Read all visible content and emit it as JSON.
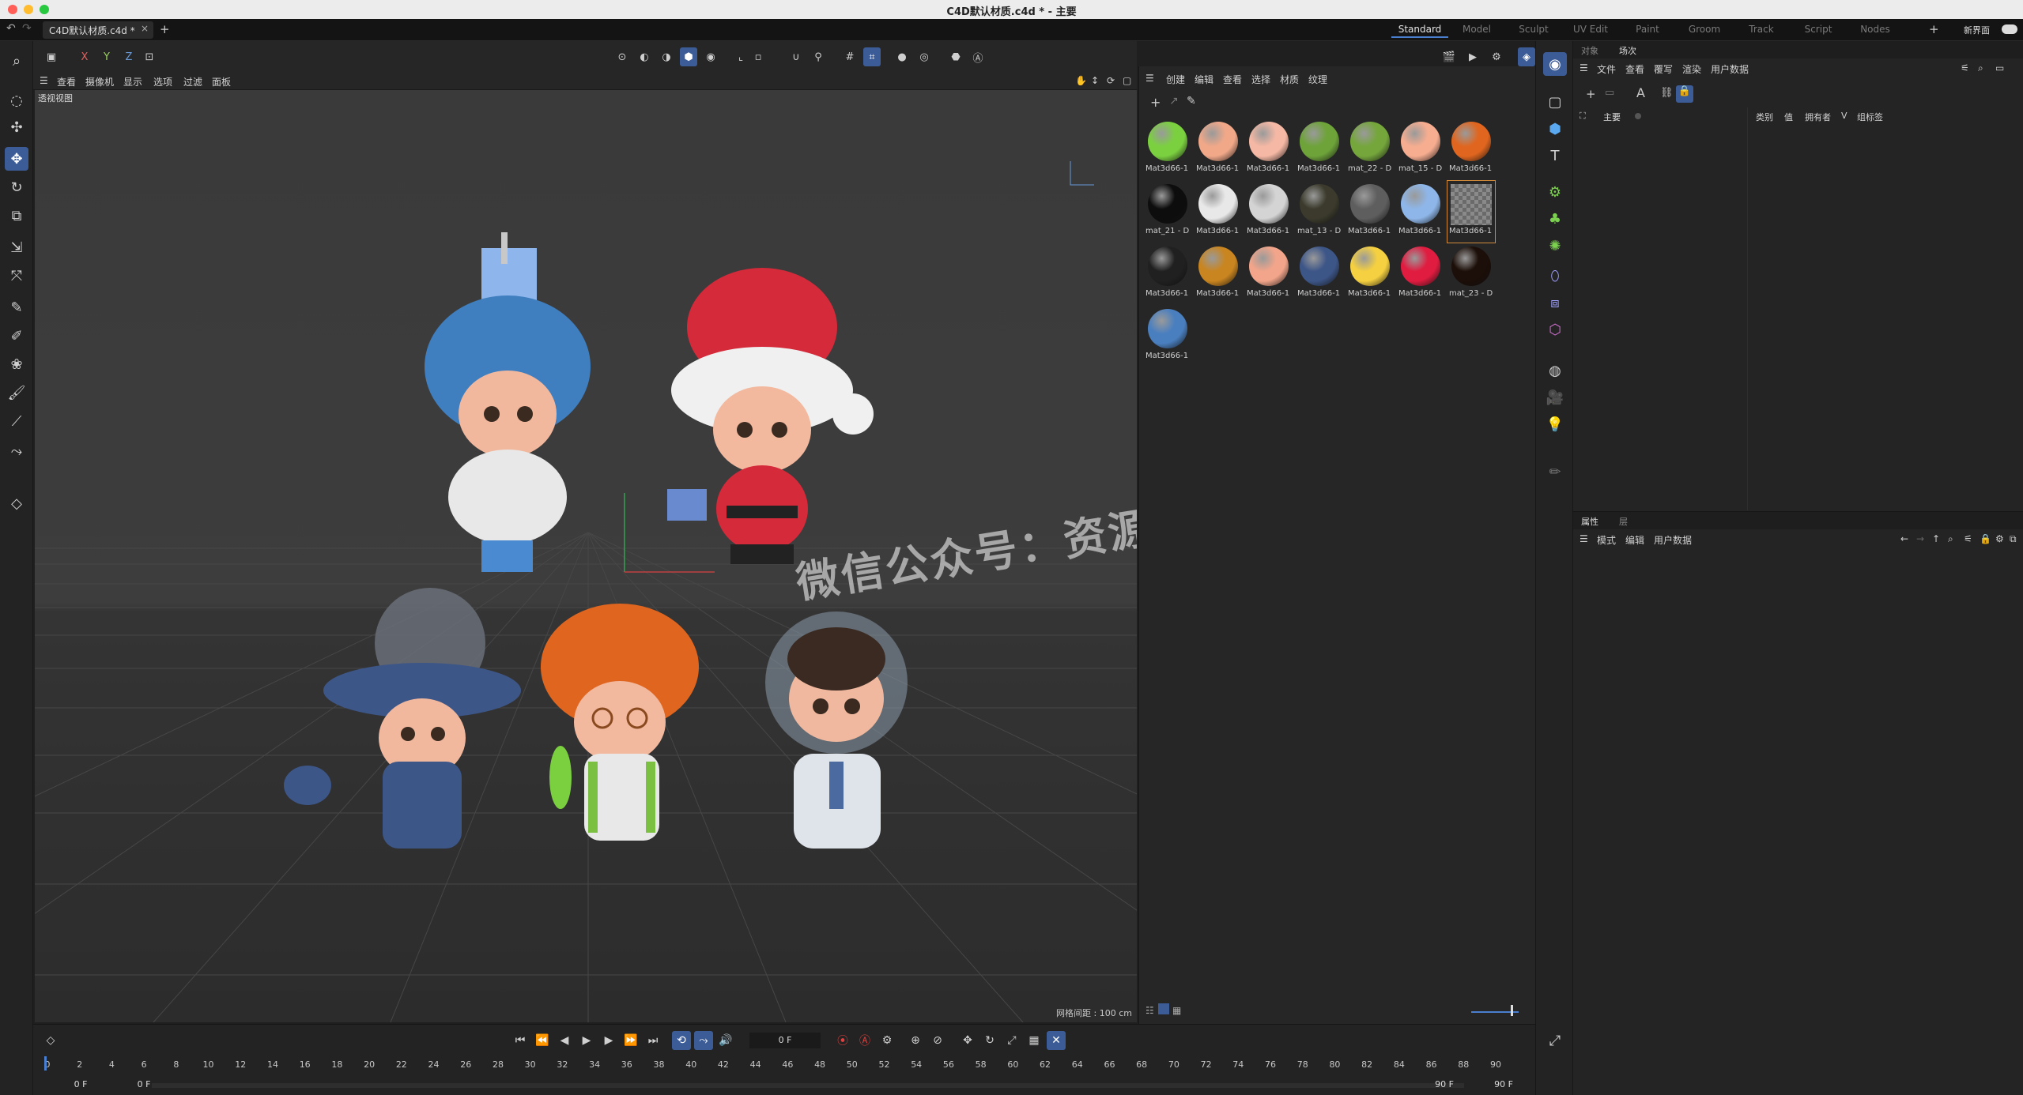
{
  "window": {
    "title": "C4D默认材质.c4d * - 主要"
  },
  "tabs": {
    "doc_tab": "C4D默认材质.c4d *",
    "close_glyph": "×",
    "add_glyph": "+"
  },
  "layouts": {
    "items": [
      "Standard",
      "Model",
      "Sculpt",
      "UV Edit",
      "Paint",
      "Groom",
      "Track",
      "Script",
      "Nodes"
    ],
    "new_layout": "新界面",
    "plus": "+"
  },
  "axis_buttons": {
    "x": "X",
    "y": "Y",
    "z": "Z"
  },
  "viewport_menu": [
    "查看",
    "摄像机",
    "显示",
    "选项",
    "过滤",
    "面板"
  ],
  "viewport": {
    "label": "透视视图",
    "grid_info": "网格间距 : 100 cm",
    "watermark": "微信公众号：资源设"
  },
  "material_menu": [
    "创建",
    "编辑",
    "查看",
    "选择",
    "材质",
    "纹理"
  ],
  "materials": [
    {
      "name": "Mat3d66-1",
      "color": "#7bd040"
    },
    {
      "name": "Mat3d66-1",
      "color": "#f0a889"
    },
    {
      "name": "Mat3d66-1",
      "color": "#f5b8a4"
    },
    {
      "name": "Mat3d66-1",
      "color": "#6ea33a"
    },
    {
      "name": "mat_22 - D",
      "color": "#75a63c"
    },
    {
      "name": "mat_15 - D",
      "color": "#f6ad90"
    },
    {
      "name": "Mat3d66-1",
      "color": "#e0661f"
    },
    {
      "name": "mat_21 - D",
      "color": "#0d0d0d"
    },
    {
      "name": "Mat3d66-1",
      "color": "#e8e8e8"
    },
    {
      "name": "Mat3d66-1",
      "color": "#d4d4d4"
    },
    {
      "name": "mat_13 - D",
      "color": "#3b3a2c"
    },
    {
      "name": "Mat3d66-1",
      "color": "#5e5e5e"
    },
    {
      "name": "Mat3d66-1",
      "color": "#8eb6e8"
    },
    {
      "name": "Mat3d66-1",
      "color": "checker"
    },
    {
      "name": "Mat3d66-1",
      "color": "#202020"
    },
    {
      "name": "Mat3d66-1",
      "color": "#c98520"
    },
    {
      "name": "Mat3d66-1",
      "color": "#f2a58a"
    },
    {
      "name": "Mat3d66-1",
      "color": "#3d5688"
    },
    {
      "name": "Mat3d66-1",
      "color": "#f5d040"
    },
    {
      "name": "Mat3d66-1",
      "color": "#e01c40"
    },
    {
      "name": "mat_23 - D",
      "color": "#1c0e08"
    },
    {
      "name": "Mat3d66-1",
      "color": "#4a7fbf"
    }
  ],
  "object_manager": {
    "tabs": [
      "对象",
      "场次"
    ],
    "menu": [
      "文件",
      "查看",
      "覆写",
      "渲染",
      "用户数据"
    ],
    "root_item": "主要",
    "columns": [
      "类别",
      "值",
      "拥有者",
      "V",
      "组标签"
    ]
  },
  "attributes": {
    "tabs": [
      "属性",
      "层"
    ],
    "menu": [
      "模式",
      "编辑",
      "用户数据"
    ]
  },
  "timeline": {
    "current_frame": "0 F",
    "start_left": "0 F",
    "start_right": "0 F",
    "end_left": "90 F",
    "end_right": "90 F",
    "ticks": [
      "0",
      "2",
      "4",
      "6",
      "8",
      "10",
      "12",
      "14",
      "16",
      "18",
      "20",
      "22",
      "24",
      "26",
      "28",
      "30",
      "32",
      "34",
      "36",
      "38",
      "40",
      "42",
      "44",
      "46",
      "48",
      "50",
      "52",
      "54",
      "56",
      "58",
      "60",
      "62",
      "64",
      "66",
      "68",
      "70",
      "72",
      "74",
      "76",
      "78",
      "80",
      "82",
      "84",
      "86",
      "88",
      "90"
    ]
  },
  "colors": {
    "accent": "#3c5c97",
    "close_dot": "#ff5f57",
    "min_dot": "#febc2e",
    "max_dot": "#28c840"
  }
}
